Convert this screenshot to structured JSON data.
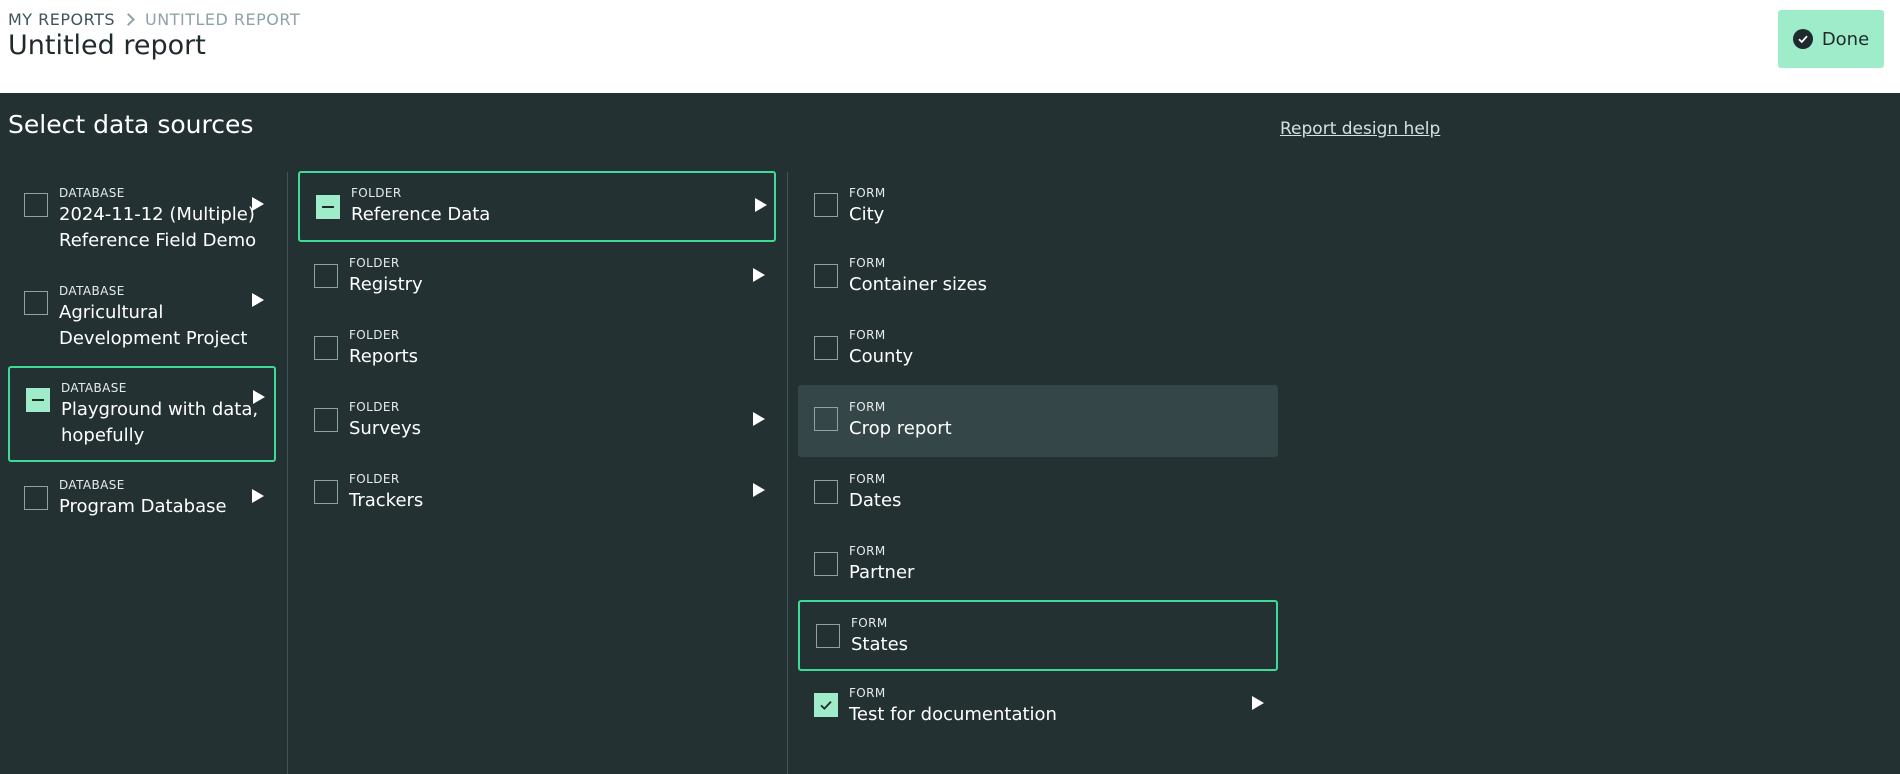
{
  "header": {
    "breadcrumb": [
      "MY REPORTS",
      "UNTITLED REPORT"
    ],
    "title": "Untitled report",
    "done_label": "Done"
  },
  "main": {
    "section_title": "Select data sources",
    "help_link": "Report design help"
  },
  "databases": [
    {
      "type": "DATABASE",
      "label": "2024-11-12 (Multiple) Reference Field Demo",
      "state": "unchecked",
      "has_children": true
    },
    {
      "type": "DATABASE",
      "label": "Agricultural Development Project",
      "state": "unchecked",
      "has_children": true
    },
    {
      "type": "DATABASE",
      "label": "Playground with data, hopefully",
      "state": "partial",
      "has_children": true
    },
    {
      "type": "DATABASE",
      "label": "Program Database",
      "state": "unchecked",
      "has_children": true
    }
  ],
  "folders": [
    {
      "type": "FOLDER",
      "label": "Reference Data",
      "state": "partial",
      "has_children": true
    },
    {
      "type": "FOLDER",
      "label": "Registry",
      "state": "unchecked",
      "has_children": true
    },
    {
      "type": "FOLDER",
      "label": "Reports",
      "state": "unchecked",
      "has_children": false
    },
    {
      "type": "FOLDER",
      "label": "Surveys",
      "state": "unchecked",
      "has_children": true
    },
    {
      "type": "FOLDER",
      "label": "Trackers",
      "state": "unchecked",
      "has_children": true
    }
  ],
  "forms": [
    {
      "type": "FORM",
      "label": "City",
      "state": "unchecked",
      "has_children": false
    },
    {
      "type": "FORM",
      "label": "Container sizes",
      "state": "unchecked",
      "has_children": false
    },
    {
      "type": "FORM",
      "label": "County",
      "state": "unchecked",
      "has_children": false
    },
    {
      "type": "FORM",
      "label": "Crop report",
      "state": "unchecked",
      "has_children": false
    },
    {
      "type": "FORM",
      "label": "Dates",
      "state": "unchecked",
      "has_children": false
    },
    {
      "type": "FORM",
      "label": "Partner",
      "state": "unchecked",
      "has_children": false
    },
    {
      "type": "FORM",
      "label": "States",
      "state": "unchecked",
      "has_children": false
    },
    {
      "type": "FORM",
      "label": "Test for documentation",
      "state": "checked",
      "has_children": true
    }
  ],
  "colors": {
    "background": "#243133",
    "accent": "#3ddb95",
    "accent_light": "#9eecc9",
    "hover": "#354649"
  }
}
